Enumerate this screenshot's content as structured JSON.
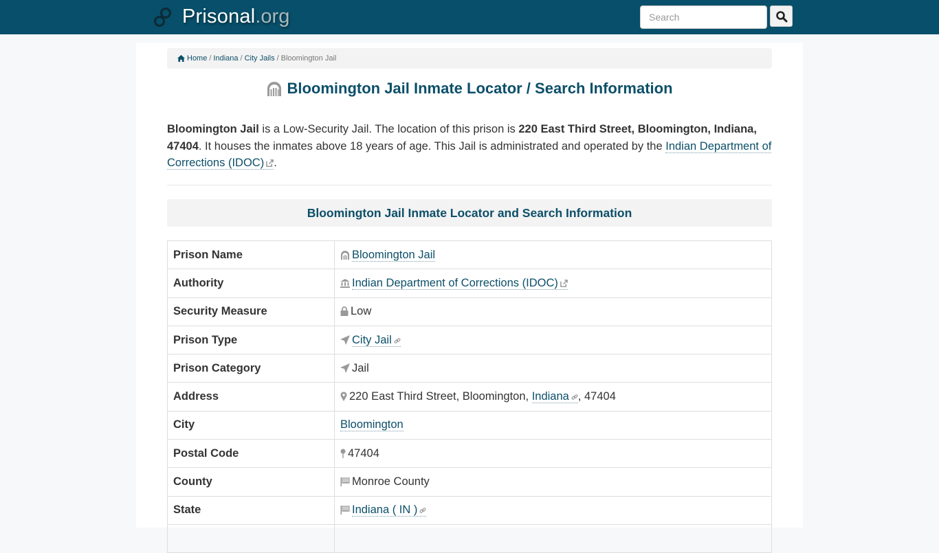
{
  "header": {
    "brand_name": "Prisonal",
    "brand_tld": ".org",
    "search_placeholder": "Search",
    "search_value": ""
  },
  "breadcrumb": [
    {
      "label": "Home"
    },
    {
      "label": "Indiana"
    },
    {
      "label": "City Jails"
    },
    {
      "label": "Bloomington Jail"
    }
  ],
  "breadcrumb_separator": "/",
  "page_title": "Bloomington Jail Inmate Locator / Search Information",
  "intro": {
    "name": "Bloomington Jail",
    "text1": " is a Low-Security Jail. The location of this prison is ",
    "address": "220 East Third Street, Bloomington, Indiana, 47404",
    "text2": ". It houses the inmates above 18 years of age. This Jail is administrated and operated by the ",
    "authority_link": "Indian Department of Corrections (IDOC)",
    "text3": "."
  },
  "section_title": "Bloomington Jail Inmate Locator and Search Information",
  "info_table": {
    "rows": [
      {
        "key": "Prison Name",
        "value": "Bloomington Jail",
        "icon": "prison-icon"
      },
      {
        "key": "Authority",
        "value": "Indian Department of Corrections (IDOC)",
        "icon": "bank-icon"
      },
      {
        "key": "Security Measure",
        "value": "Low",
        "icon": "lock-icon"
      },
      {
        "key": "Prison Type",
        "value": "City Jail",
        "icon": "location-arrow-icon"
      },
      {
        "key": "Prison Category",
        "value": "Jail",
        "icon": "location-arrow-icon"
      },
      {
        "key": "Address",
        "value_prefix": "220 East Third Street, Bloomington, ",
        "value_link": "Indiana",
        "value_suffix": ", 47404",
        "icon": "map-marker-icon"
      },
      {
        "key": "City",
        "value": "Bloomington"
      },
      {
        "key": "Postal Code",
        "value": "47404",
        "icon": "map-pin-icon"
      },
      {
        "key": "County",
        "value": "Monroe County",
        "icon": "flag-icon"
      },
      {
        "key": "State",
        "value": "Indiana ( IN )",
        "icon": "flag-icon"
      }
    ]
  },
  "colors": {
    "navbar": "#074f6a",
    "accent": "#0c4f69",
    "icon_gray": "#8a8a8a"
  }
}
